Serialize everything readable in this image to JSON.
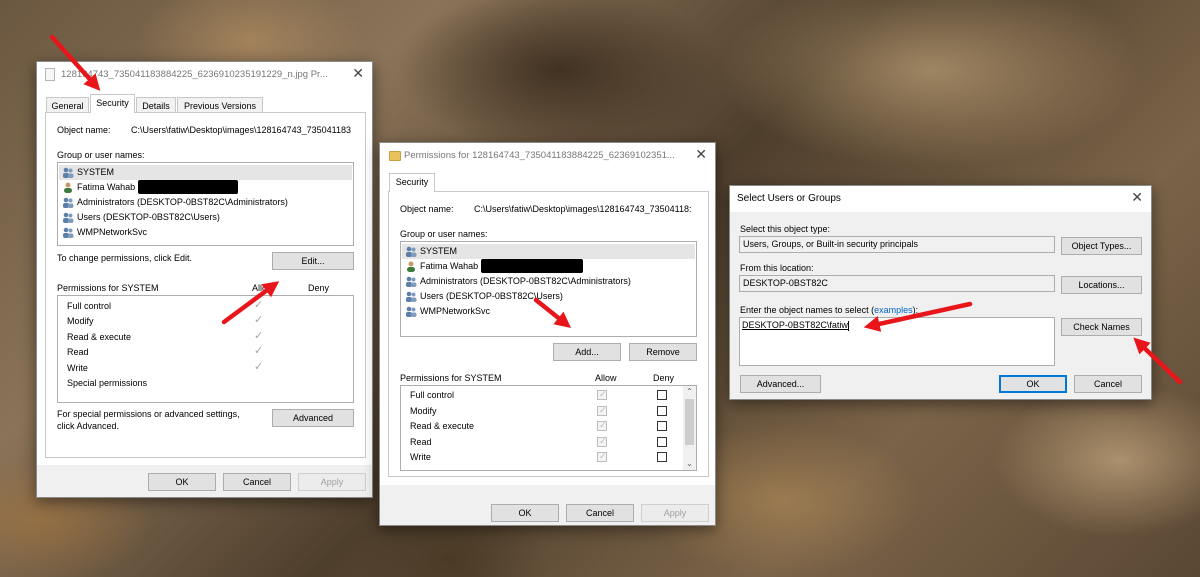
{
  "colors": {
    "accent": "#0078d7",
    "arrow": "#e8161b",
    "link": "#0066cc"
  },
  "props": {
    "title": "128164743_735041183884225_6236910235191229_n.jpg Pr...",
    "tabs": [
      "General",
      "Security",
      "Details",
      "Previous Versions"
    ],
    "object_name_label": "Object name:",
    "object_name_value": "C:\\Users\\fatiw\\Desktop\\images\\128164743_735041183",
    "group_label": "Group or user names:",
    "users": [
      "SYSTEM",
      "Fatima Wahab",
      "Administrators (DESKTOP-0BST82C\\Administrators)",
      "Users (DESKTOP-0BST82C\\Users)",
      "WMPNetworkSvc"
    ],
    "change_text": "To change permissions, click Edit.",
    "edit_label": "Edit...",
    "perm_label": "Permissions for SYSTEM",
    "allow_label": "Allow",
    "deny_label": "Deny",
    "perms": [
      "Full control",
      "Modify",
      "Read & execute",
      "Read",
      "Write",
      "Special permissions"
    ],
    "special_text_1": "For special permissions or advanced settings,",
    "special_text_2": "click Advanced.",
    "advanced_label": "Advanced",
    "ok": "OK",
    "cancel": "Cancel",
    "apply": "Apply"
  },
  "perm_dialog": {
    "title": "Permissions for 128164743_735041183884225_62369102351...",
    "tab": "Security",
    "object_name_label": "Object name:",
    "object_name_value": "C:\\Users\\fatiw\\Desktop\\images\\128164743_73504118:",
    "group_label": "Group or user names:",
    "users": [
      "SYSTEM",
      "Fatima Wahab",
      "Administrators (DESKTOP-0BST82C\\Administrators)",
      "Users (DESKTOP-0BST82C\\Users)",
      "WMPNetworkSvc"
    ],
    "add_label": "Add...",
    "remove_label": "Remove",
    "perm_label": "Permissions for SYSTEM",
    "allow_label": "Allow",
    "deny_label": "Deny",
    "perms": [
      "Full control",
      "Modify",
      "Read & execute",
      "Read",
      "Write"
    ],
    "ok": "OK",
    "cancel": "Cancel",
    "apply": "Apply"
  },
  "select_dialog": {
    "title": "Select Users or Groups",
    "object_type_label": "Select this object type:",
    "object_type_value": "Users, Groups, or Built-in security principals",
    "object_types_button": "Object Types...",
    "location_label": "From this location:",
    "location_value": "DESKTOP-0BST82C",
    "locations_button": "Locations...",
    "enter_label": "Enter the object names to select (",
    "examples_link": "examples",
    "enter_label_end": "):",
    "enter_value": "DESKTOP-0BST82C\\fatiw",
    "check_names_button": "Check Names",
    "advanced_button": "Advanced...",
    "ok": "OK",
    "cancel": "Cancel"
  }
}
